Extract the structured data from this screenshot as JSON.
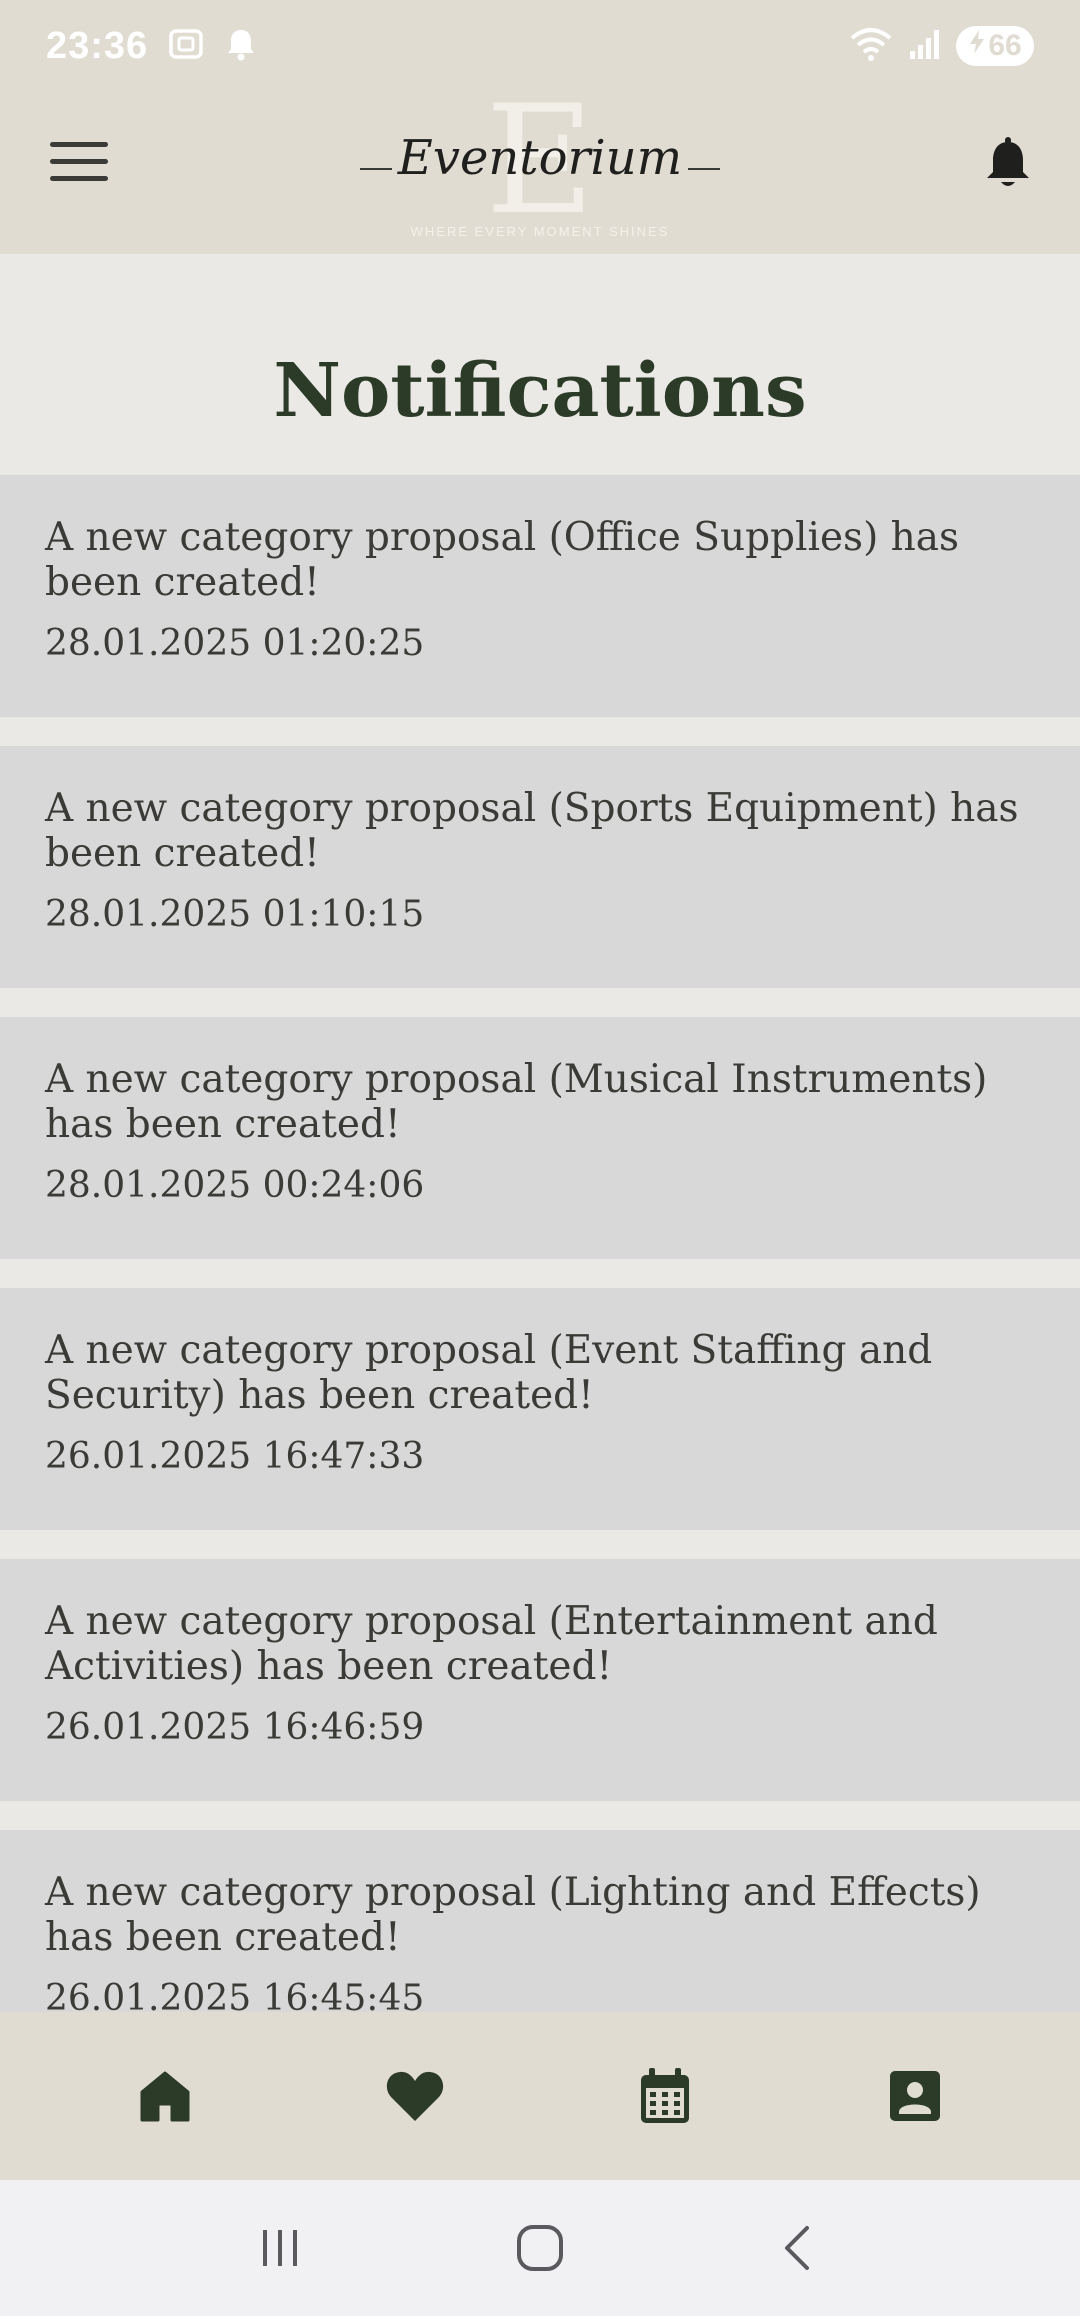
{
  "status_bar": {
    "time": "23:36",
    "battery": "66",
    "icons": [
      "screenshot-icon",
      "notification-bell-icon",
      "wifi-icon",
      "signal-icon",
      "battery-charging-icon"
    ]
  },
  "header": {
    "logo_letter": "E",
    "logo_text": "Eventorium",
    "logo_tagline": "WHERE EVERY MOMENT SHINES"
  },
  "page": {
    "title": "Notifications"
  },
  "notifications": [
    {
      "message": "A new category proposal (Office Supplies) has been created!",
      "time": "28.01.2025 01:20:25"
    },
    {
      "message": "A new category proposal (Sports Equipment) has been created!",
      "time": "28.01.2025 01:10:15"
    },
    {
      "message": "A new category proposal (Musical Instruments) has been created!",
      "time": "28.01.2025 00:24:06"
    },
    {
      "message": "A new category proposal (Event Staffing and Security) has been created!",
      "time": "26.01.2025 16:47:33"
    },
    {
      "message": "A new category proposal (Entertainment and Activities) has been created!",
      "time": "26.01.2025 16:46:59"
    },
    {
      "message": "A new category proposal (Lighting and Effects) has been created!",
      "time": "26.01.2025 16:45:45"
    }
  ],
  "bottom_nav": [
    "home-icon",
    "heart-icon",
    "calendar-icon",
    "contact-card-icon"
  ],
  "colors": {
    "header_bg": "#e0dcd2",
    "page_bg": "#eae9e5",
    "card_bg": "#d8d8d8",
    "accent_dark": "#2c3a28"
  }
}
